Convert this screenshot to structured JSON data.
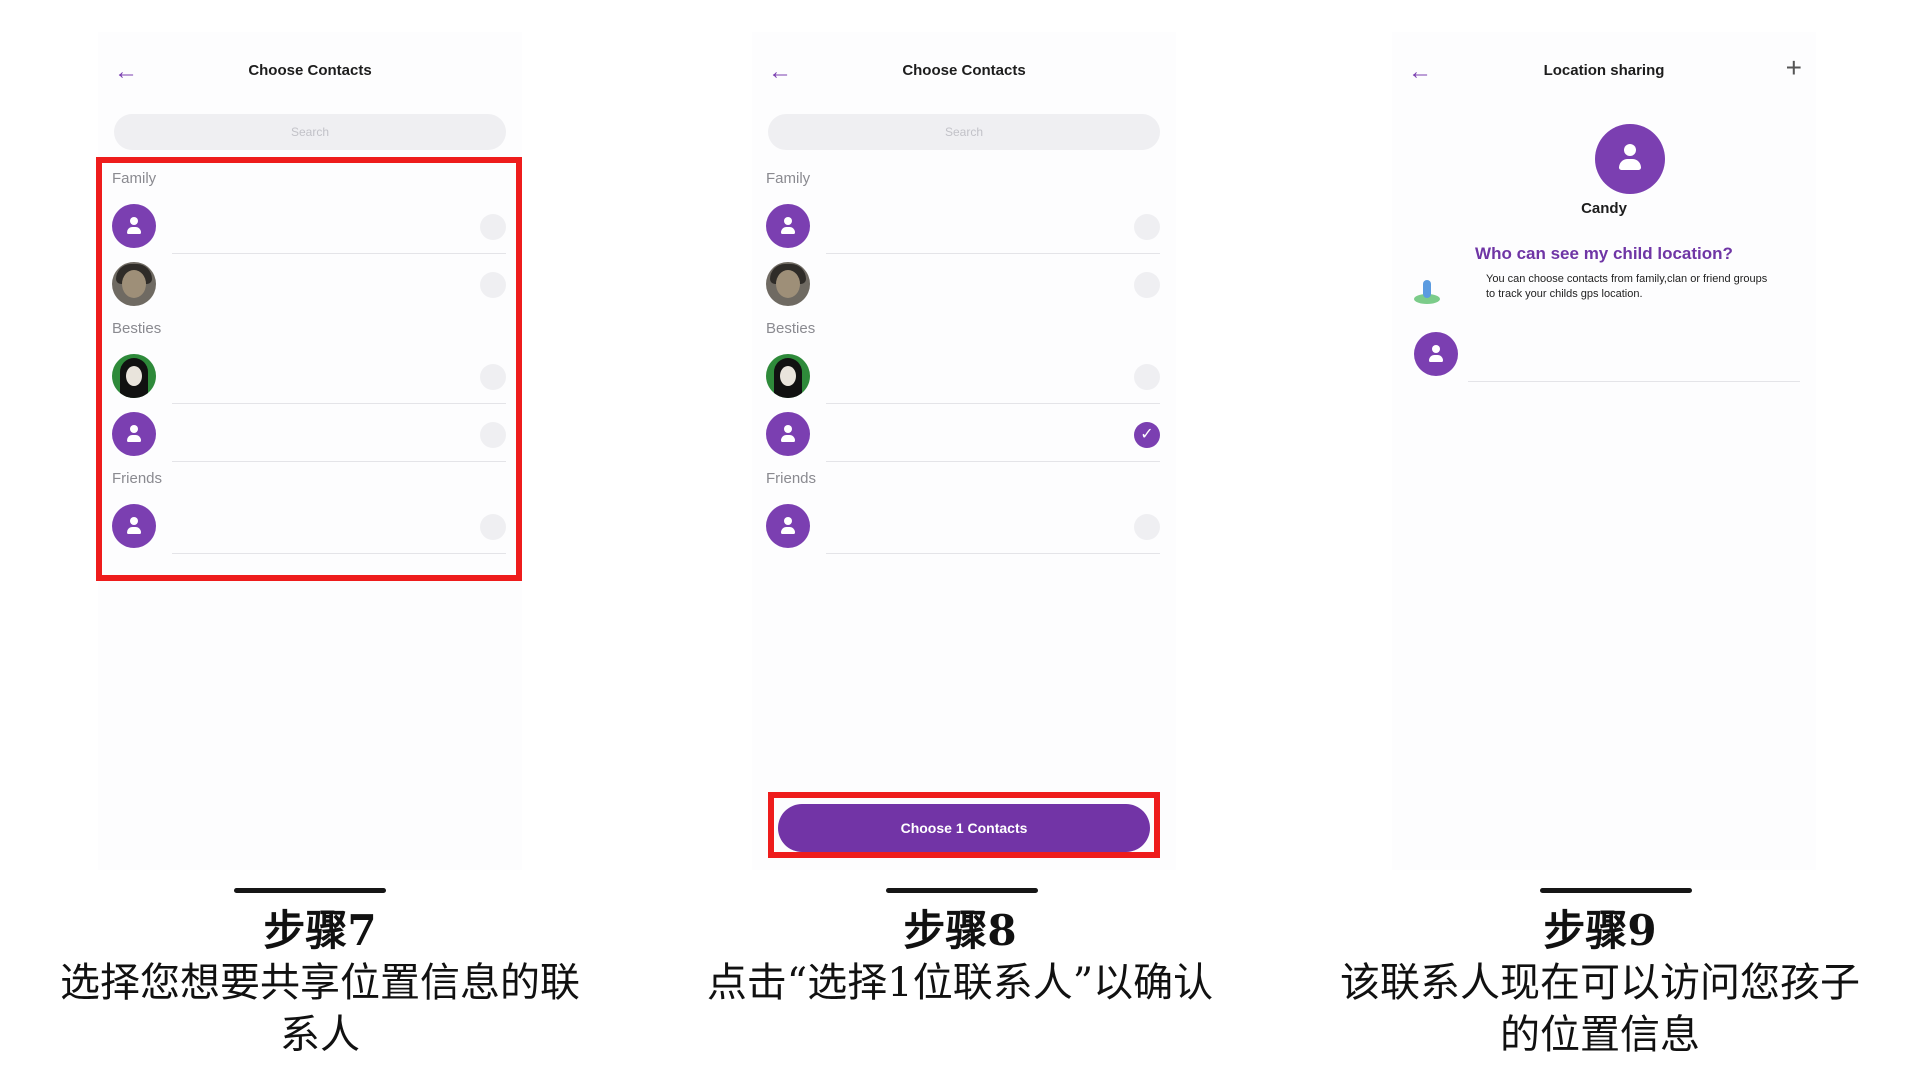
{
  "panel1": {
    "title": "Choose Contacts",
    "search_placeholder": "Search",
    "groups": [
      "Family",
      "Besties",
      "Friends"
    ],
    "step": "步骤7",
    "caption_line1": "选择您想要共享位置信息的联",
    "caption_line2": "系人"
  },
  "panel2": {
    "title": "Choose Contacts",
    "search_placeholder": "Search",
    "groups": [
      "Family",
      "Besties",
      "Friends"
    ],
    "button": "Choose 1 Contacts",
    "step": "步骤8",
    "caption_line1": "点击“选择1位联系人”以确认"
  },
  "panel3": {
    "title": "Location sharing",
    "name": "Candy",
    "question": "Who can see my child location?",
    "info_line1": "You can choose contacts from family,clan or friend groups",
    "info_line2": "to track your childs gps location.",
    "step": "步骤9",
    "caption_line1": "该联系人现在可以访问您孩子",
    "caption_line2": "的位置信息"
  },
  "colors": {
    "accent": "#7b3fb1",
    "highlight": "#ee1c1c",
    "button": "#7234a6"
  },
  "icons": {
    "back": "arrow-left-icon",
    "add": "plus-icon",
    "person": "person-icon",
    "check": "checkmark-icon"
  }
}
